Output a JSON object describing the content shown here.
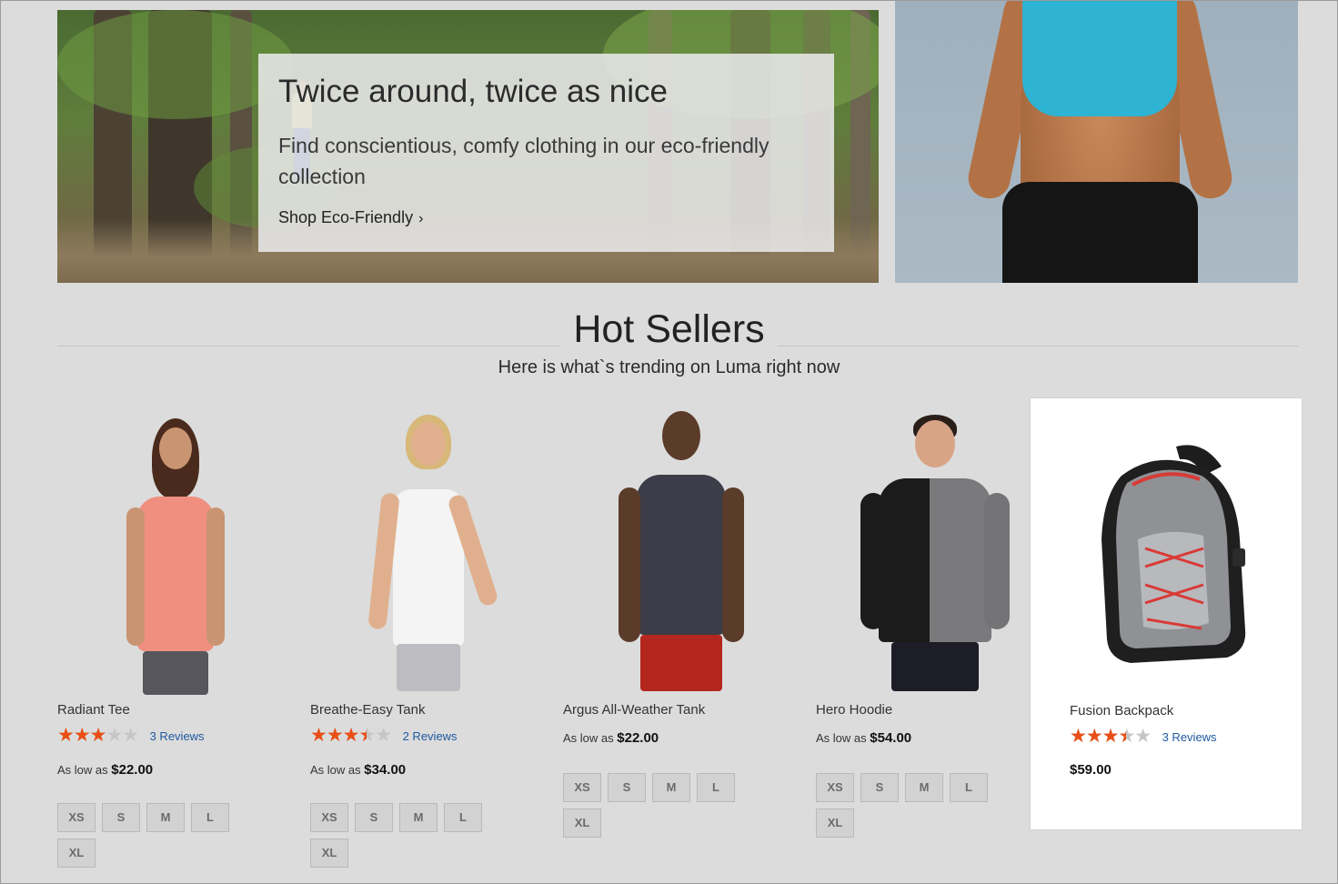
{
  "banner": {
    "title": "Twice around, twice as nice",
    "text": "Find conscientious, comfy clothing in our eco-friendly collection",
    "link_label": "Shop Eco-Friendly",
    "link_icon": "chevron-right-icon"
  },
  "section": {
    "title": "Hot Sellers",
    "subtitle": "Here is what`s trending on Luma right now"
  },
  "colors": {
    "star": "#e84f16",
    "link": "#1e5aa0",
    "background": "#dcdcdc"
  },
  "products": [
    {
      "name": "Radiant Tee",
      "rating_fraction": 0.6,
      "reviews": "3  Reviews",
      "price_prefix": "As low as",
      "price": "$22.00",
      "sizes": [
        "XS",
        "S",
        "M",
        "L",
        "XL"
      ]
    },
    {
      "name": "Breathe-Easy Tank",
      "rating_fraction": 0.7,
      "reviews": "2  Reviews",
      "price_prefix": "As low as",
      "price": "$34.00",
      "sizes": [
        "XS",
        "S",
        "M",
        "L",
        "XL"
      ]
    },
    {
      "name": "Argus All-Weather Tank",
      "price_prefix": "As low as",
      "price": "$22.00",
      "sizes": [
        "XS",
        "S",
        "M",
        "L",
        "XL"
      ]
    },
    {
      "name": "Hero Hoodie",
      "price_prefix": "As low as",
      "price": "$54.00",
      "sizes": [
        "XS",
        "S",
        "M",
        "L",
        "XL"
      ]
    },
    {
      "name": "Fusion Backpack",
      "rating_fraction": 0.7,
      "reviews": "3  Reviews",
      "price": "$59.00"
    }
  ]
}
